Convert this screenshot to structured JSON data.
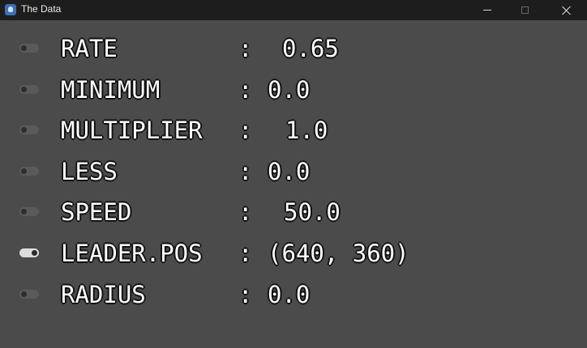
{
  "window": {
    "title": "The Data",
    "icon": "app-icon",
    "controls": [
      "minimize-icon",
      "maximize-icon",
      "close-icon"
    ]
  },
  "rows": [
    {
      "key": "RATE",
      "value": "0.65",
      "toggle_on": false
    },
    {
      "key": "MINIMUM",
      "value": "0.0",
      "toggle_on": false
    },
    {
      "key": "MULTIPLIER",
      "value": "1.0",
      "toggle_on": false
    },
    {
      "key": "LESS",
      "value": "0.0",
      "toggle_on": false
    },
    {
      "key": "SPEED",
      "value": "50.0",
      "toggle_on": false
    },
    {
      "key": "LEADER.POS",
      "value": "(640, 360)",
      "toggle_on": true
    },
    {
      "key": "RADIUS",
      "value": "0.0",
      "toggle_on": false
    }
  ],
  "separator": ":",
  "colors": {
    "background": "#4b4b4b",
    "titlebar": "#1d1d1d",
    "text": "#ffffff",
    "text_outline": "#111111",
    "toggle_on": "#dcdcdc",
    "toggle_off": "#5a5a5a"
  }
}
